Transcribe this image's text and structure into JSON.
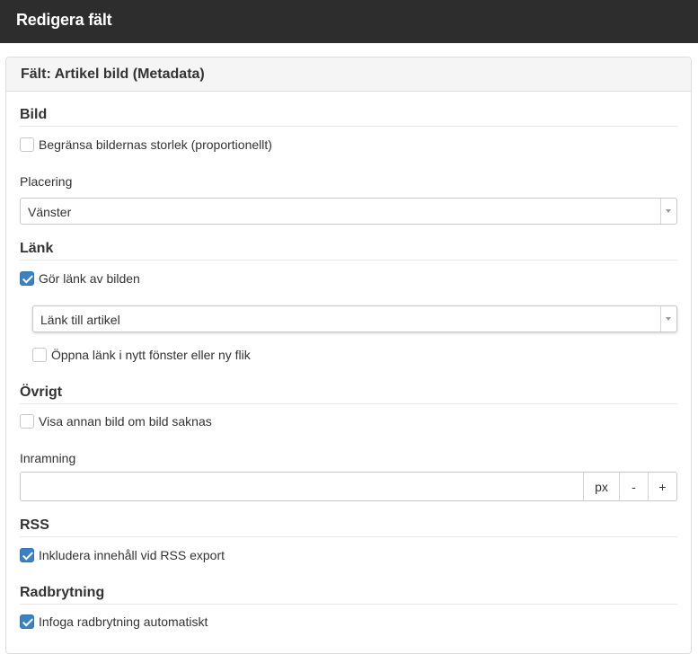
{
  "window": {
    "title": "Redigera fält"
  },
  "panel": {
    "title": "Fält: Artikel bild (Metadata)"
  },
  "sections": {
    "bild": {
      "title": "Bild",
      "limit_size": {
        "label": "Begränsa bildernas storlek (proportionellt)",
        "checked": false
      },
      "placement": {
        "label": "Placering",
        "value": "Vänster"
      }
    },
    "lank": {
      "title": "Länk",
      "make_link": {
        "label": "Gör länk av bilden",
        "checked": true
      },
      "link_target": {
        "value": "Länk till artikel"
      },
      "open_new": {
        "label": "Öppna länk i nytt fönster eller ny flik",
        "checked": false
      }
    },
    "ovrigt": {
      "title": "Övrigt",
      "show_other": {
        "label": "Visa annan bild om bild saknas",
        "checked": false
      },
      "framing": {
        "label": "Inramning",
        "value": "",
        "unit": "px",
        "decrement": "-",
        "increment": "+"
      }
    },
    "rss": {
      "title": "RSS",
      "include": {
        "label": "Inkludera innehåll vid RSS export",
        "checked": true
      }
    },
    "radbrytning": {
      "title": "Radbrytning",
      "auto": {
        "label": "Infoga radbrytning automatiskt",
        "checked": true
      }
    }
  },
  "colors": {
    "topbar": "#2d2d2d",
    "checkbox_checked": "#3b82c4",
    "panel_header": "#f5f5f5"
  }
}
